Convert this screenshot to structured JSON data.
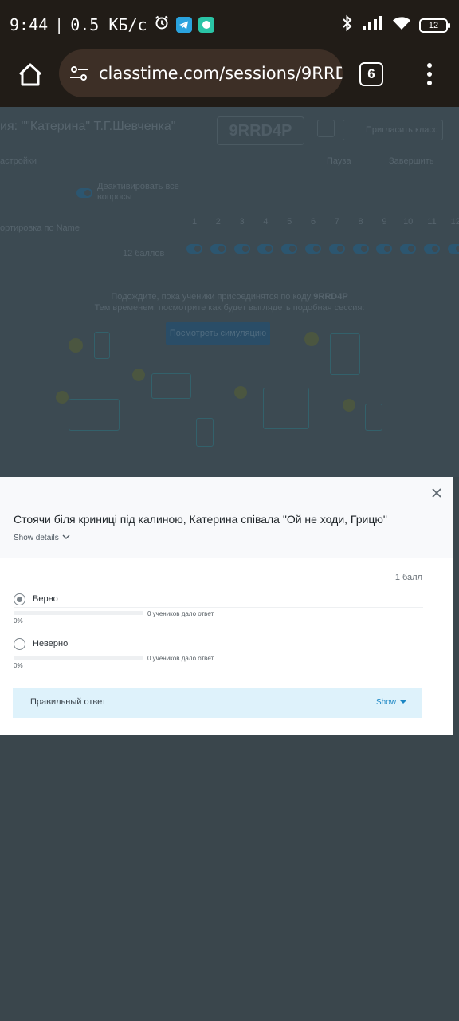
{
  "status_bar": {
    "time": "9:44",
    "speed": "0.5 КБ/с",
    "battery": "12"
  },
  "browser": {
    "url": "classtime.com/sessions/9RRD'",
    "tabs_count": "6"
  },
  "background_page": {
    "class_title": "ия: \"\"Катерина\" Т.Г.Шевченка\"",
    "session_code": "9RRD4P",
    "invite_label": "Пригласить класс",
    "settings_label": "астройки",
    "pause_label": "Пауза",
    "finish_label": "Завершить",
    "deactivate_label": "Деактивировать все вопросы",
    "sort_label": "ортировка по Name",
    "points_label": "12 баллов",
    "question_numbers": [
      "1",
      "2",
      "3",
      "4",
      "5",
      "6",
      "7",
      "8",
      "9",
      "10",
      "11",
      "12"
    ],
    "waiting_line_1": "Подождите, пока ученики присоединятся по коду",
    "waiting_code": "9RRD4P",
    "waiting_line_2": "Тем временем, посмотрите как будет выглядеть подобная сессия:",
    "simulation_button": "Посмотреть симуляцию"
  },
  "modal": {
    "question": "Стоячи біля криниці під калиною, Катерина співала \"Ой не ходи, Грицю\"",
    "show_details": "Show details",
    "points": "1 балл",
    "options": [
      {
        "label": "Верно",
        "count_text": "0 учеников дало ответ",
        "percent": "0%",
        "selected": true
      },
      {
        "label": "Неверно",
        "count_text": "0 учеников дало ответ",
        "percent": "0%",
        "selected": false
      }
    ],
    "correct_answer_label": "Правильный ответ",
    "correct_answer_show": "Show"
  },
  "colors": {
    "accent": "#1a86c4",
    "overlay": "#3a464c",
    "browser_chrome": "#211c17"
  }
}
